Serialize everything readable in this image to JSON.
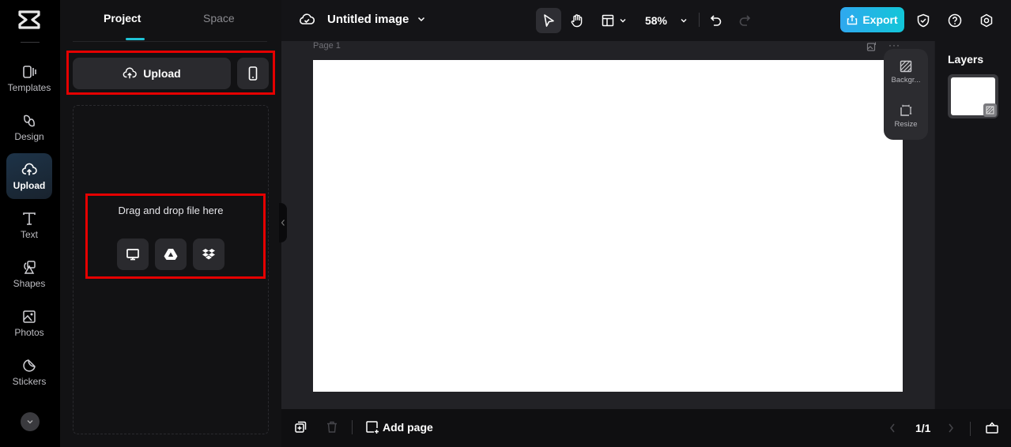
{
  "rail": {
    "items": [
      {
        "label": "Templates",
        "icon": "templates-icon"
      },
      {
        "label": "Design",
        "icon": "design-icon"
      },
      {
        "label": "Upload",
        "icon": "upload-cloud-icon",
        "active": true
      },
      {
        "label": "Text",
        "icon": "text-icon"
      },
      {
        "label": "Shapes",
        "icon": "shapes-icon"
      },
      {
        "label": "Photos",
        "icon": "photos-icon"
      },
      {
        "label": "Stickers",
        "icon": "stickers-icon"
      }
    ],
    "more_icon": "chevron-down-icon"
  },
  "panel": {
    "tabs": [
      {
        "label": "Project",
        "active": true
      },
      {
        "label": "Space",
        "active": false
      }
    ],
    "upload_label": "Upload",
    "drop_text": "Drag and drop file here",
    "sources": [
      "computer-icon",
      "google-drive-icon",
      "dropbox-icon"
    ]
  },
  "topbar": {
    "title": "Untitled image",
    "zoom": "58%",
    "export_label": "Export"
  },
  "canvas": {
    "page_label": "Page 1",
    "more": "···",
    "floatbar": [
      {
        "label": "Backgr..."
      },
      {
        "label": "Resize"
      }
    ]
  },
  "layers": {
    "title": "Layers"
  },
  "bottombar": {
    "add_page_label": "Add page",
    "page_count": "1/1"
  },
  "colors": {
    "accent": "#1fc3d6",
    "export_gradient_start": "#2fa8ef",
    "export_gradient_end": "#12c6d8",
    "highlight_box": "#e50000"
  }
}
